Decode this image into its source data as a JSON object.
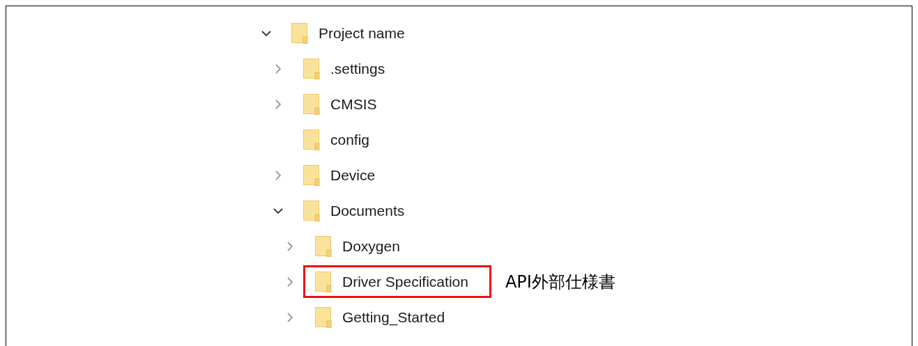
{
  "tree": {
    "label": "Project name",
    "expanded": true,
    "highlighted": false,
    "children": [
      {
        "label": ".settings",
        "expanded": false,
        "highlighted": false
      },
      {
        "label": "CMSIS",
        "expanded": false,
        "highlighted": false
      },
      {
        "label": "config",
        "highlighted": false
      },
      {
        "label": "Device",
        "expanded": false,
        "highlighted": false
      },
      {
        "label": "Documents",
        "expanded": true,
        "highlighted": false,
        "children": [
          {
            "label": "Doxygen",
            "expanded": false,
            "highlighted": false
          },
          {
            "label": "Driver Specification",
            "expanded": false,
            "highlighted": true,
            "callout": "API外部仕様書"
          },
          {
            "label": "Getting_Started",
            "expanded": false,
            "highlighted": false
          }
        ]
      }
    ]
  }
}
